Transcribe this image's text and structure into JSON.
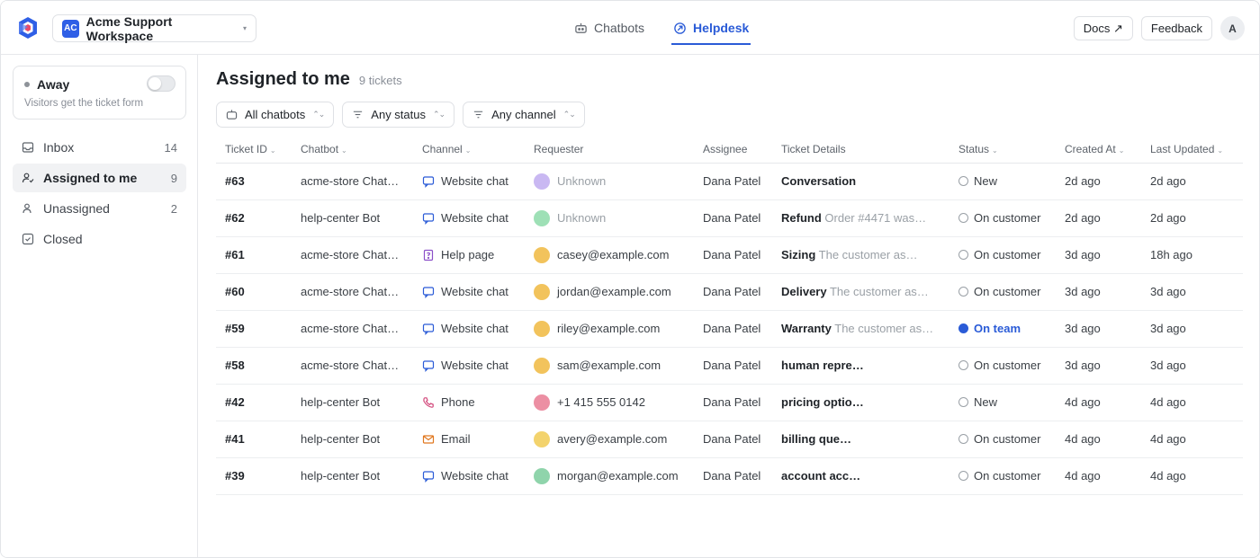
{
  "workspace": {
    "badge": "AC",
    "name": "Acme Support Workspace",
    "caret": "▾"
  },
  "tabs": [
    {
      "label": "Chatbots",
      "icon": "bot-icon",
      "active": false
    },
    {
      "label": "Helpdesk",
      "icon": "helpdesk-icon",
      "active": true
    }
  ],
  "topbar": {
    "docs": "Docs ↗",
    "feedback": "Feedback",
    "avatar": "A"
  },
  "presence": {
    "label": "Away",
    "sub": "Visitors get the ticket form"
  },
  "nav": [
    {
      "label": "Inbox",
      "count": "14",
      "icon": "inbox-icon"
    },
    {
      "label": "Assigned to me",
      "count": "9",
      "icon": "user-check-icon",
      "active": true
    },
    {
      "label": "Unassigned",
      "count": "2",
      "icon": "user-icon"
    },
    {
      "label": "Closed",
      "count": "",
      "icon": "check-square-icon"
    }
  ],
  "main": {
    "title": "Assigned to me",
    "count": "9 tickets"
  },
  "filters": {
    "chatbots": "All chatbots",
    "status": "Any status",
    "channel": "Any channel",
    "chevron": "⌃⌄"
  },
  "columns": {
    "id": "Ticket ID",
    "chatbot": "Chatbot",
    "channel": "Channel",
    "requester": "Requester",
    "assignee": "Assignee",
    "details": "Ticket Details",
    "status": "Status",
    "created": "Created At",
    "updated": "Last Updated",
    "sort": "⌄"
  },
  "colors": {
    "accent": "#2a5bd7",
    "purple": "#c9b8f2",
    "green": "#9ee0b6",
    "amber": "#f2c35c",
    "pink": "#ec8fa3",
    "gold": "#f3d36d",
    "mint": "#8fd4ab"
  },
  "rows": [
    {
      "id": "#63",
      "chatbot": "acme-store Chat…",
      "channel": "Website chat",
      "ch_icon": "chat-icon",
      "requester": "Unknown",
      "unknown": true,
      "dot": "#c9b8f2",
      "assignee": "Dana Patel",
      "title": "Conversation",
      "sub": "",
      "status": "New",
      "status_kind": "open",
      "created": "2d ago",
      "updated": "2d ago"
    },
    {
      "id": "#62",
      "chatbot": "help-center Bot",
      "channel": "Website chat",
      "ch_icon": "chat-icon",
      "requester": "Unknown",
      "unknown": true,
      "dot": "#9ee0b6",
      "assignee": "Dana Patel",
      "title": "Refund",
      "sub": "Order #4471 was…",
      "status": "On customer",
      "status_kind": "open",
      "created": "2d ago",
      "updated": "2d ago"
    },
    {
      "id": "#61",
      "chatbot": "acme-store Chat…",
      "channel": "Help page",
      "ch_icon": "page-icon",
      "requester": "casey@example.com",
      "unknown": false,
      "dot": "#f2c35c",
      "assignee": "Dana Patel",
      "title": "Sizing",
      "sub": "The customer as…",
      "status": "On customer",
      "status_kind": "open",
      "created": "3d ago",
      "updated": "18h ago"
    },
    {
      "id": "#60",
      "chatbot": "acme-store Chat…",
      "channel": "Website chat",
      "ch_icon": "chat-icon",
      "requester": "jordan@example.com",
      "unknown": false,
      "dot": "#f2c35c",
      "assignee": "Dana Patel",
      "title": "Delivery",
      "sub": "The customer as…",
      "status": "On customer",
      "status_kind": "open",
      "created": "3d ago",
      "updated": "3d ago"
    },
    {
      "id": "#59",
      "chatbot": "acme-store Chat…",
      "channel": "Website chat",
      "ch_icon": "chat-icon",
      "requester": "riley@example.com",
      "unknown": false,
      "dot": "#f2c35c",
      "assignee": "Dana Patel",
      "title": "Warranty",
      "sub": "The customer as…",
      "status": "On team",
      "status_kind": "team",
      "created": "3d ago",
      "updated": "3d ago"
    },
    {
      "id": "#58",
      "chatbot": "acme-store Chat…",
      "channel": "Website chat",
      "ch_icon": "chat-icon",
      "requester": "sam@example.com",
      "unknown": false,
      "dot": "#f2c35c",
      "assignee": "Dana Patel",
      "title": "human repre…",
      "sub": "",
      "status": "On customer",
      "status_kind": "open",
      "created": "3d ago",
      "updated": "3d ago"
    },
    {
      "id": "#42",
      "chatbot": "help-center Bot",
      "channel": "Phone",
      "ch_icon": "phone-icon",
      "requester": "+1 415 555 0142",
      "unknown": false,
      "dot": "#ec8fa3",
      "assignee": "Dana Patel",
      "title": "pricing optio…",
      "sub": "",
      "status": "New",
      "status_kind": "open",
      "created": "4d ago",
      "updated": "4d ago"
    },
    {
      "id": "#41",
      "chatbot": "help-center Bot",
      "channel": "Email",
      "ch_icon": "mail-icon",
      "requester": "avery@example.com",
      "unknown": false,
      "dot": "#f3d36d",
      "assignee": "Dana Patel",
      "title": "billing que…",
      "sub": "",
      "status": "On customer",
      "status_kind": "open",
      "created": "4d ago",
      "updated": "4d ago"
    },
    {
      "id": "#39",
      "chatbot": "help-center Bot",
      "channel": "Website chat",
      "ch_icon": "chat-icon",
      "requester": "morgan@example.com",
      "unknown": false,
      "dot": "#8fd4ab",
      "assignee": "Dana Patel",
      "title": "account acc…",
      "sub": "",
      "status": "On customer",
      "status_kind": "open",
      "created": "4d ago",
      "updated": "4d ago"
    }
  ]
}
